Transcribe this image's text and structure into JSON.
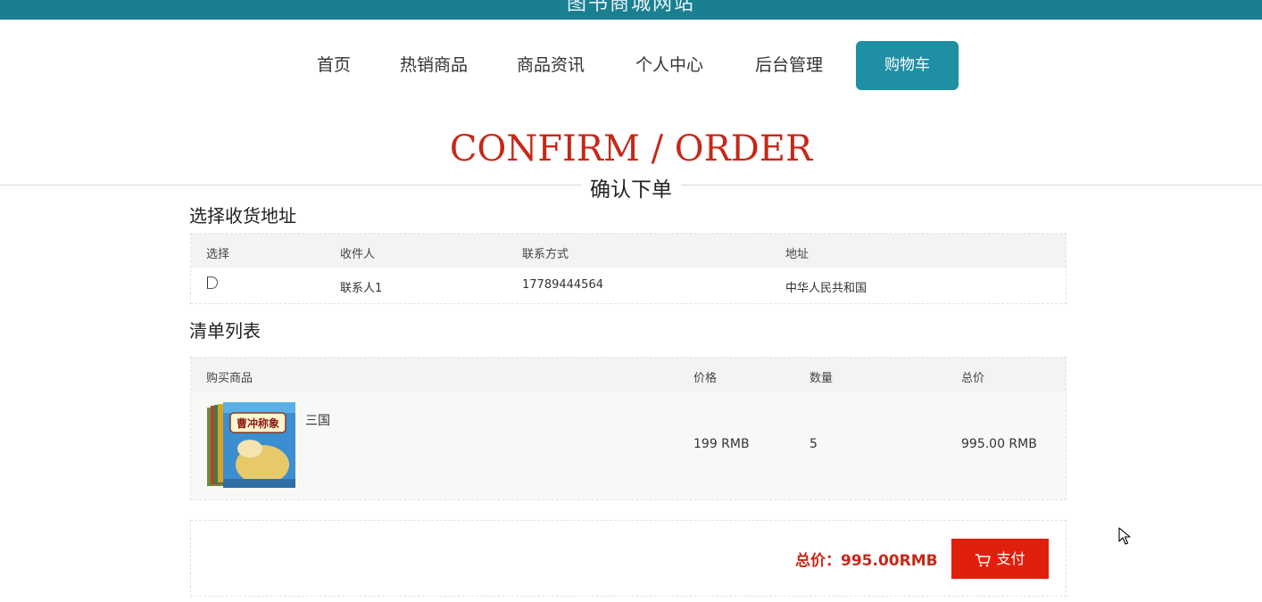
{
  "header": {
    "site_title": "图书商城网站"
  },
  "nav": {
    "items": [
      {
        "label": "首页"
      },
      {
        "label": "热销商品"
      },
      {
        "label": "商品资讯"
      },
      {
        "label": "个人中心"
      },
      {
        "label": "后台管理"
      },
      {
        "label": "购物车",
        "active": true
      }
    ]
  },
  "page": {
    "title_en": "CONFIRM / ORDER",
    "title_cn": "确认下单"
  },
  "address_section": {
    "title": "选择收货地址",
    "columns": [
      "选择",
      "收件人",
      "联系方式",
      "地址"
    ],
    "rows": [
      {
        "recipient": "联系人1",
        "phone": "17789444564",
        "address": "中华人民共和国"
      }
    ]
  },
  "list_section": {
    "title": "清单列表",
    "columns": [
      "购买商品",
      "价格",
      "数量",
      "总价"
    ],
    "items": [
      {
        "name": "三国",
        "cover_text": "曹冲称象",
        "price": "199 RMB",
        "quantity": "5",
        "subtotal": "995.00 RMB"
      }
    ]
  },
  "summary": {
    "total_label": "总价：995.00RMB",
    "pay_label": "支付"
  },
  "colors": {
    "header_bg": "#1a7f91",
    "accent": "#1f8fa3",
    "title_red": "#c62818",
    "pay_red": "#e0200d"
  },
  "icons": [
    "cart-icon",
    "mouse-pointer-icon"
  ]
}
